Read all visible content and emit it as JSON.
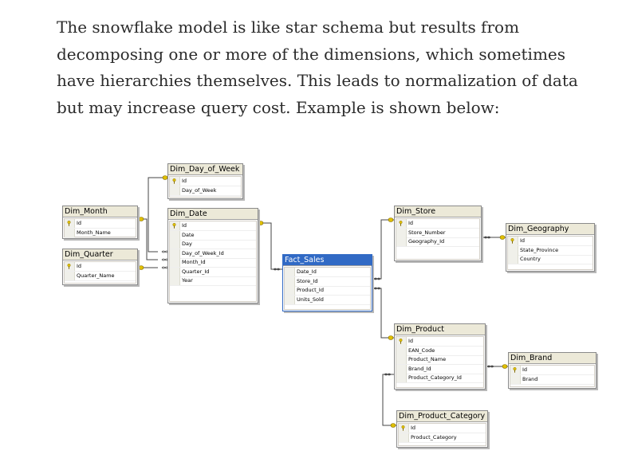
{
  "paragraph": "The snowflake model is like star schema but results from decomposing one or more of the dimensions, which sometimes have hierarchies themselves. This leads to normalization of data but may increase query cost. Example is shown below:",
  "colors": {
    "text": "#2b2b2b",
    "selected_header": "#316ac5",
    "header": "#ece9d8",
    "key": "#e0c000"
  },
  "tables": {
    "dim_day_of_week": {
      "name": "Dim_Day_of_Week",
      "columns": [
        "Id",
        "Day_of_Week"
      ]
    },
    "dim_month": {
      "name": "Dim_Month",
      "columns": [
        "Id",
        "Month_Name"
      ]
    },
    "dim_quarter": {
      "name": "Dim_Quarter",
      "columns": [
        "Id",
        "Quarter_Name"
      ]
    },
    "dim_date": {
      "name": "Dim_Date",
      "columns": [
        "Id",
        "Date",
        "Day",
        "Day_of_Week_Id",
        "Month_Id",
        "Quarter_Id",
        "Year"
      ]
    },
    "fact_sales": {
      "name": "Fact_Sales",
      "columns": [
        "Date_Id",
        "Store_Id",
        "Product_Id",
        "Units_Sold"
      ]
    },
    "dim_store": {
      "name": "Dim_Store",
      "columns": [
        "Id",
        "Store_Number",
        "Geography_Id"
      ]
    },
    "dim_geography": {
      "name": "Dim_Geography",
      "columns": [
        "Id",
        "State_Province",
        "Country"
      ]
    },
    "dim_product": {
      "name": "Dim_Product",
      "columns": [
        "Id",
        "EAN_Code",
        "Product_Name",
        "Brand_Id",
        "Product_Category_Id"
      ]
    },
    "dim_brand": {
      "name": "Dim_Brand",
      "columns": [
        "Id",
        "Brand"
      ]
    },
    "dim_product_category": {
      "name": "Dim_Product_Category",
      "columns": [
        "Id",
        "Product_Category"
      ]
    }
  }
}
